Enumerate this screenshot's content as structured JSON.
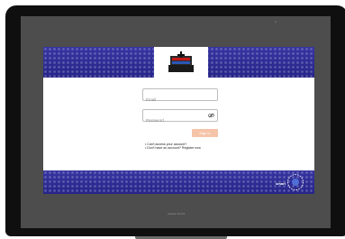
{
  "login": {
    "email_placeholder": "Email",
    "password_placeholder": "Password",
    "signin_label": "Sign In",
    "link_forgot": "Can't access your account?",
    "link_register": "Don't have an account? Register now"
  },
  "footer": {
    "brand_word": "smart",
    "version": "Version 10.0.0"
  },
  "icons": {
    "logo": "sentry-logo-icon",
    "eye": "eye-off-icon",
    "smart": "smart-badge-icon"
  },
  "colors": {
    "band": "#2c2a9c",
    "signin_button": "#f5c4a8",
    "screen_bezel": "#0f0f0f"
  }
}
